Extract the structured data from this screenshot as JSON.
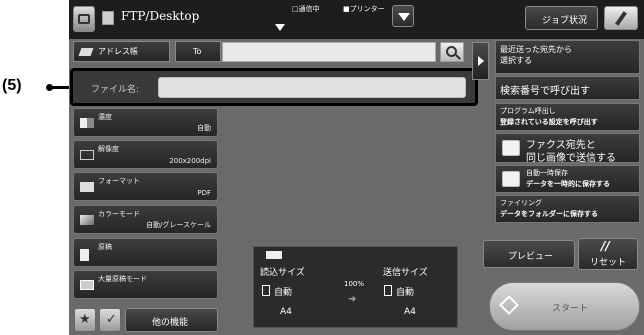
{
  "callout": {
    "label": "(5)"
  },
  "header": {
    "mode_title": "FTP/Desktop",
    "status_comm": "□通信中",
    "status_printer": "■プリンター",
    "job_status": "ジョブ状況"
  },
  "address": {
    "address_book": "アドレス帳",
    "to_label": "To",
    "filename_label": "ファイル名:",
    "filename_value": ""
  },
  "left_settings": [
    {
      "label": "濃度",
      "value": "自動"
    },
    {
      "label": "解像度",
      "value": "200x200dpi"
    },
    {
      "label": "フォーマット",
      "value": "PDF"
    },
    {
      "label": "カラーモード",
      "value": "自動/グレースケール"
    },
    {
      "label": "原稿",
      "value": ""
    },
    {
      "label": "大量原稿モード",
      "value": ""
    }
  ],
  "right_panel": {
    "recent_line1": "最近送った宛先から",
    "recent_line2": "選択する",
    "search_number": "検索番号で呼び出す",
    "program_line1": "プログラム呼出し",
    "program_line2": "登録されている設定を呼び出す",
    "fax_line1": "ファクス宛先と",
    "fax_line2": "同じ画像で送信する",
    "autosave_line1": "自動一時保存",
    "autosave_line2": "データを一時的に保存する",
    "filing_line1": "ファイリング",
    "filing_line2": "データをフォルダーに保存する"
  },
  "scan_info": {
    "read_size_label": "読込サイズ",
    "read_size_value": "自動",
    "read_paper": "A4",
    "ratio": "100%",
    "send_size_label": "送信サイズ",
    "send_size_value": "自動",
    "send_paper": "A4"
  },
  "actions": {
    "preview": "プレビュー",
    "reset_mark": "//",
    "reset": "リセット",
    "start": "スタート",
    "other_functions": "他の機能"
  }
}
